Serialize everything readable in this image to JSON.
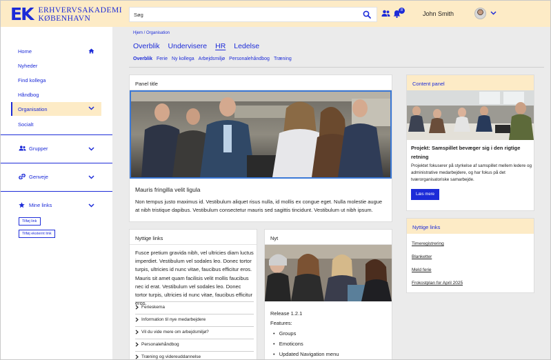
{
  "header": {
    "logo_mark": "EK",
    "logo_line1": "ERHVERVSAKADEMI",
    "logo_line2": "KØBENHAVN",
    "search_placeholder": "Søg",
    "notification_count": "8",
    "user_name": "John Smith"
  },
  "sidebar": {
    "items": [
      {
        "label": "Home"
      },
      {
        "label": "Nyheder"
      },
      {
        "label": "Find kollega"
      },
      {
        "label": "Håndbog"
      },
      {
        "label": "Organisation"
      },
      {
        "label": "Socialt"
      }
    ],
    "groups_label": "Grupper",
    "shortcuts_label": "Genveje",
    "mylinks_label": "Mine links",
    "add_link_label": "Tilføj link",
    "add_external_link_label": "Tilføj eksternt link"
  },
  "main": {
    "breadcrumb": "Hjem / Organisation",
    "tabs": [
      {
        "label": "Overblik"
      },
      {
        "label": "Undervisere"
      },
      {
        "label": "HR"
      },
      {
        "label": "Ledelse"
      }
    ],
    "subtabs": [
      {
        "label": "Overblik"
      },
      {
        "label": "Ferie"
      },
      {
        "label": "Ny kollega"
      },
      {
        "label": "Arbejdsmiljø"
      },
      {
        "label": "Personalehåndbog"
      },
      {
        "label": "Træning"
      }
    ],
    "panel": {
      "title": "Panel title",
      "heading": "Mauris fringilla velit ligula",
      "body": "Non tempus justo maximus id. Vestibulum aliquet risus nulla, id mollis ex congue eget. Nulla molestie augue at nibh tristique dapibus. Vestibulum consectetur mauris sed sagittis tincidunt. Vestibulum ut nibh ipsum."
    },
    "useful": {
      "title": "Nyttige links",
      "body": "Fusce pretium gravida nibh, vel ultricies diam luctus imperdiet. Vestibulum vel sodales leo. Donec tortor turpis, ultricies id nunc vitae, faucibus efficitur eros. Mauris sit amet quam facilisis velit mollis faucibus nec id erat. Vestibulum vel sodales leo. Donec tortor turpis, ultricies id nunc vitae, faucibus efficitur eros.",
      "links": [
        {
          "label": "Ferieskema"
        },
        {
          "label": "Information til nye medarbejdere"
        },
        {
          "label": "Vil du vide mere om arbejdsmiljø?"
        },
        {
          "label": "Personalehåndbog"
        },
        {
          "label": "Træning og videreuddannelse"
        }
      ]
    },
    "news": {
      "title": "Nyt",
      "release": "Release 1.2.1",
      "features_label": "Features:",
      "features": [
        "Groups",
        "Emoticons",
        "Updated Navigation menu"
      ]
    }
  },
  "right": {
    "content_panel": {
      "title": "Content panel",
      "heading": "Projekt: Samspillet bevæger sig i den rigtige retning",
      "body": "Projektet fokuserer på styrkelse af samspillet mellem ledere og administrative medarbejdere, og har fokus på det tværorganisatoriske samarbejde.",
      "button": "Læs mere"
    },
    "useful_links": {
      "title": "Nyttige links",
      "links": [
        {
          "label": "Timeregistrering"
        },
        {
          "label": "Blanketter"
        },
        {
          "label": "Meld ferie"
        },
        {
          "label": "Frokostplan for April 2025"
        }
      ]
    }
  },
  "colors": {
    "accent": "#1c2bd8",
    "header_bg": "#fdebc6"
  }
}
